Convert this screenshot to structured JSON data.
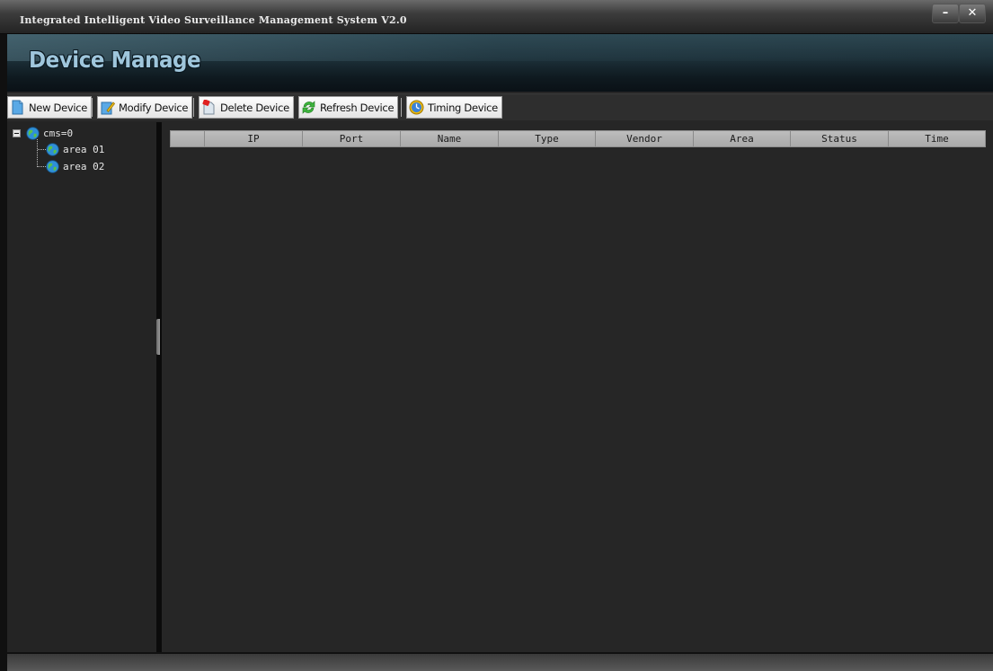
{
  "window": {
    "title": "Integrated Intelligent Video Surveillance Management System V2.0",
    "minimize_label": "–",
    "close_label": "✕"
  },
  "banner": {
    "title": "Device Manage"
  },
  "toolbar": {
    "buttons": [
      {
        "label": "New Device",
        "icon": "new-document-icon"
      },
      {
        "label": "Modify Device",
        "icon": "edit-icon"
      },
      {
        "label": "Delete Device",
        "icon": "delete-icon"
      },
      {
        "label": "Refresh Device",
        "icon": "refresh-icon"
      },
      {
        "label": "Timing Device",
        "icon": "clock-icon"
      }
    ]
  },
  "tree": {
    "root": {
      "label": "cms=0",
      "icon": "globe-icon"
    },
    "children": [
      {
        "label": "area 01",
        "icon": "globe-icon"
      },
      {
        "label": "area 02",
        "icon": "globe-icon"
      }
    ]
  },
  "table": {
    "columns": [
      "",
      "IP",
      "Port",
      "Name",
      "Type",
      "Vendor",
      "Area",
      "Status",
      "Time"
    ],
    "rows": []
  },
  "colors": {
    "background": "#262626",
    "banner_text": "#9fc6dc",
    "header_bg": "#b4b4b4"
  }
}
